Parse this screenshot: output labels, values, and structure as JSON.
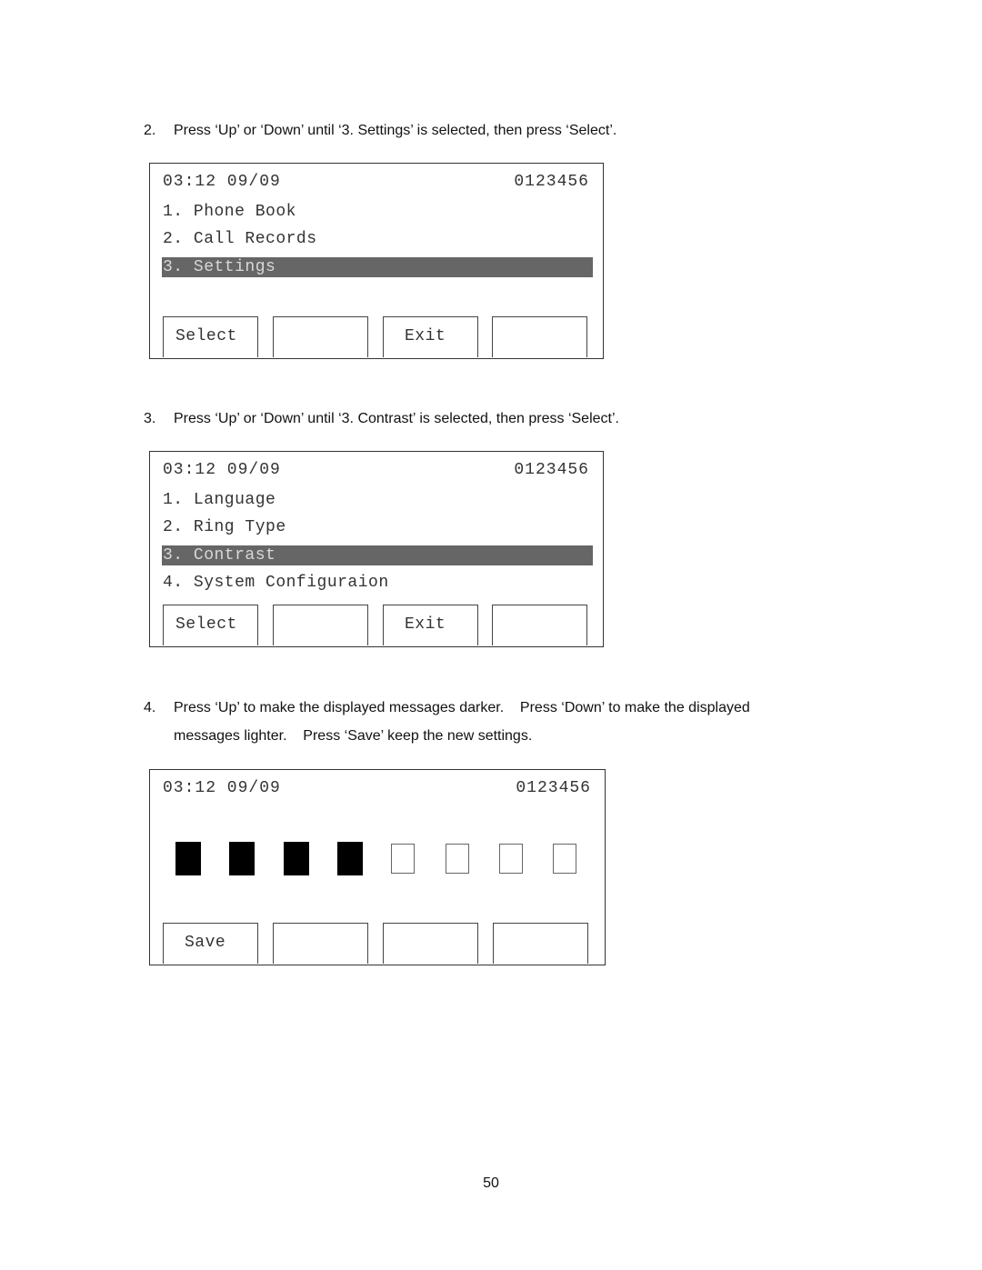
{
  "steps": [
    {
      "number": "2.",
      "text": "Press ‘Up’ or ‘Down’ until ‘3. Settings’ is selected, then press ‘Select’."
    },
    {
      "number": "3.",
      "text": "Press ‘Up’ or ‘Down’ until ‘3. Contrast’ is selected, then press ‘Select’."
    },
    {
      "number": "4.",
      "text_line1": "Press ‘Up’ to make the displayed messages darker.    Press ‘Down’ to make the displayed",
      "text_line2": "messages lighter.    Press ‘Save’ keep the new settings."
    }
  ],
  "screens": [
    {
      "time_date": "03:12 09/09",
      "number": "0123456",
      "menu": [
        "1. Phone Book",
        "2. Call Records",
        "3. Settings"
      ],
      "selected_index": 2,
      "softkeys": [
        "Select",
        "",
        "Exit",
        ""
      ]
    },
    {
      "time_date": "03:12 09/09",
      "number": "0123456",
      "menu": [
        "1. Language",
        "2. Ring Type",
        "3. Contrast",
        "4. System Configuraion"
      ],
      "selected_index": 2,
      "softkeys": [
        "Select",
        "",
        "Exit",
        ""
      ]
    },
    {
      "time_date": "03:12 09/09",
      "number": "0123456",
      "contrast_level": 4,
      "contrast_max": 8,
      "softkeys": [
        "Save",
        "",
        "",
        ""
      ]
    }
  ],
  "page_number": "50"
}
